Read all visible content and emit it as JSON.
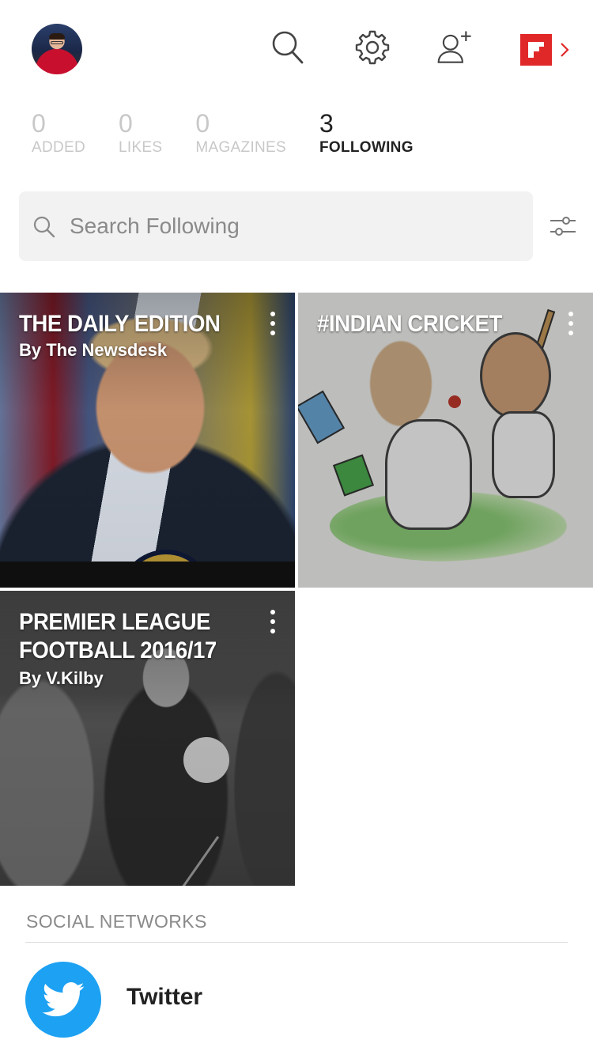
{
  "header": {
    "avatar_icon": "user-avatar",
    "search_icon": "search-icon",
    "settings_icon": "gear-icon",
    "add_user_icon": "add-user-icon",
    "brand_icon": "flipboard-logo-icon",
    "brand_color": "#e12828"
  },
  "stats": [
    {
      "value": "0",
      "label": "ADDED"
    },
    {
      "value": "0",
      "label": "LIKES"
    },
    {
      "value": "0",
      "label": "MAGAZINES"
    },
    {
      "value": "3",
      "label": "FOLLOWING"
    }
  ],
  "search": {
    "placeholder": "Search Following"
  },
  "tiles": [
    {
      "title": "THE DAILY EDITION",
      "byline": "By The Newsdesk"
    },
    {
      "title": "#INDIAN CRICKET",
      "byline": ""
    },
    {
      "title": "PREMIER LEAGUE FOOTBALL 2016/17",
      "byline": "By V.Kilby"
    }
  ],
  "social": {
    "section_title": "SOCIAL NETWORKS",
    "items": [
      {
        "label": "Twitter",
        "icon": "twitter-icon",
        "color": "#1da1f2"
      }
    ]
  }
}
